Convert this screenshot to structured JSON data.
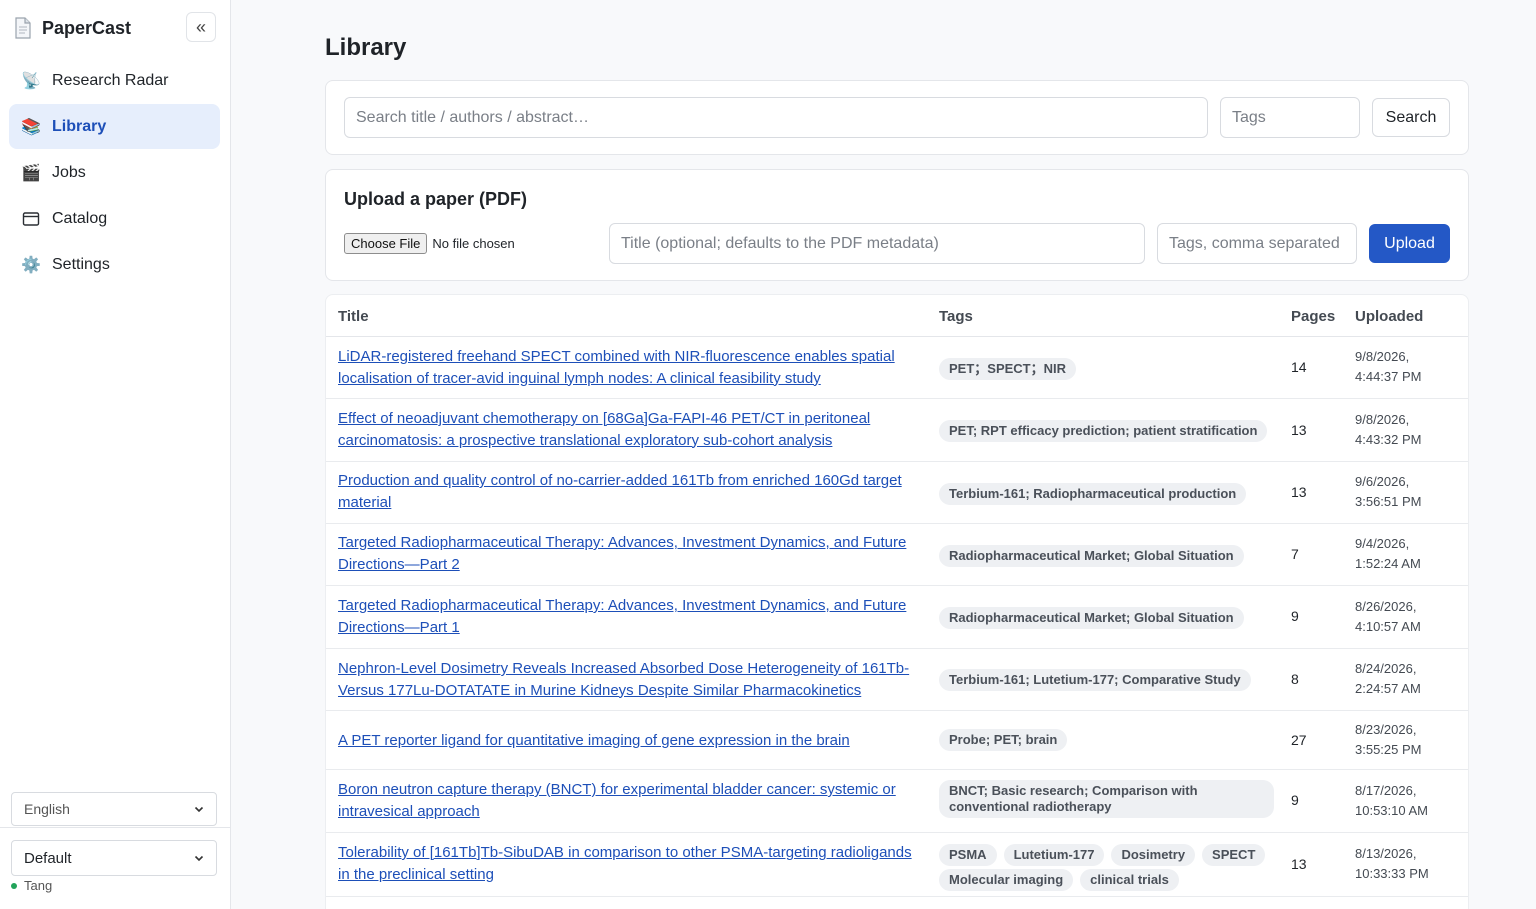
{
  "app": {
    "name": "PaperCast",
    "brand_icon": "document-icon",
    "collapse_icon": "double-chevron-left-icon",
    "collapse_glyph": "«"
  },
  "nav": [
    {
      "label": "Research Radar",
      "icon": "satellite-antenna-icon",
      "glyph": "📡",
      "active": false
    },
    {
      "label": "Library",
      "icon": "books-icon",
      "glyph": "📚",
      "active": true
    },
    {
      "label": "Jobs",
      "icon": "clapper-board-icon",
      "glyph": "🎬",
      "active": false
    },
    {
      "label": "Catalog",
      "icon": "window-icon",
      "glyph": "🗔",
      "active": false
    },
    {
      "label": "Settings",
      "icon": "gear-icon",
      "glyph": "⚙️",
      "active": false
    }
  ],
  "sidebar_footer": {
    "language": "English",
    "theme": "Default",
    "user": "Tang",
    "status_color": "#22a35a"
  },
  "page": {
    "title": "Library"
  },
  "search": {
    "query_placeholder": "Search title / authors / abstract…",
    "tags_placeholder": "Tags",
    "button": "Search"
  },
  "upload": {
    "title": "Upload a paper (PDF)",
    "file_button": "Choose File",
    "file_status": "No file chosen",
    "title_placeholder": "Title (optional; defaults to the PDF metadata)",
    "tags_placeholder": "Tags, comma separated",
    "button": "Upload"
  },
  "colors": {
    "accent": "#2458c6",
    "link": "#1d4fb8",
    "active_nav_bg": "#e6eefc"
  },
  "table": {
    "headers": {
      "title": "Title",
      "tags": "Tags",
      "pages": "Pages",
      "uploaded": "Uploaded"
    },
    "rows": [
      {
        "title": "LiDAR-registered freehand SPECT combined with NIR-fluorescence enables spatial localisation of tracer-avid inguinal lymph nodes: A clinical feasibility study",
        "tags": [
          "PET；SPECT；NIR"
        ],
        "pages": "14",
        "date": "9/8/2026,",
        "time": "4:44:37 PM"
      },
      {
        "title": "Effect of neoadjuvant chemotherapy on [68Ga]Ga-FAPI-46 PET/CT in peritoneal carcinomatosis: a prospective translational exploratory sub-cohort analysis",
        "tags": [
          "PET; RPT efficacy prediction; patient stratification"
        ],
        "pages": "13",
        "date": "9/8/2026,",
        "time": "4:43:32 PM"
      },
      {
        "title": "Production and quality control of no-carrier-added 161Tb from enriched 160Gd target material",
        "tags": [
          "Terbium-161; Radiopharmaceutical production"
        ],
        "pages": "13",
        "date": "9/6/2026,",
        "time": "3:56:51 PM"
      },
      {
        "title": "Targeted Radiopharmaceutical Therapy: Advances, Investment Dynamics, and Future Directions—Part 2",
        "tags": [
          "Radiopharmaceutical Market; Global Situation"
        ],
        "pages": "7",
        "date": "9/4/2026,",
        "time": "1:52:24 AM"
      },
      {
        "title": "Targeted Radiopharmaceutical Therapy: Advances, Investment Dynamics, and Future Directions—Part 1",
        "tags": [
          "Radiopharmaceutical Market; Global Situation"
        ],
        "pages": "9",
        "date": "8/26/2026,",
        "time": "4:10:57 AM"
      },
      {
        "title": "Nephron-Level Dosimetry Reveals Increased Absorbed Dose Heterogeneity of 161Tb- Versus 177Lu-DOTATATE in Murine Kidneys Despite Similar Pharmacokinetics",
        "tags": [
          "Terbium-161; Lutetium-177; Comparative Study"
        ],
        "pages": "8",
        "date": "8/24/2026,",
        "time": "2:24:57 AM"
      },
      {
        "title": "A PET reporter ligand for quantitative imaging of gene expression in the brain",
        "tags": [
          "Probe; PET; brain"
        ],
        "pages": "27",
        "date": "8/23/2026,",
        "time": "3:55:25 PM"
      },
      {
        "title": "Boron neutron capture therapy (BNCT) for experimental bladder cancer: systemic or intravesical approach",
        "tags": [
          "BNCT; Basic research; Comparison with conventional radiotherapy"
        ],
        "pages": "9",
        "date": "8/17/2026,",
        "time": "10:53:10 AM"
      },
      {
        "title": "Tolerability of [161Tb]Tb-SibuDAB in comparison to other PSMA-targeting radioligands in the preclinical setting",
        "tags": [
          "PSMA",
          "Lutetium-177",
          "Dosimetry",
          "SPECT",
          "Molecular imaging",
          "clinical trials"
        ],
        "pages": "13",
        "date": "8/13/2026,",
        "time": "10:33:33 PM"
      }
    ]
  }
}
